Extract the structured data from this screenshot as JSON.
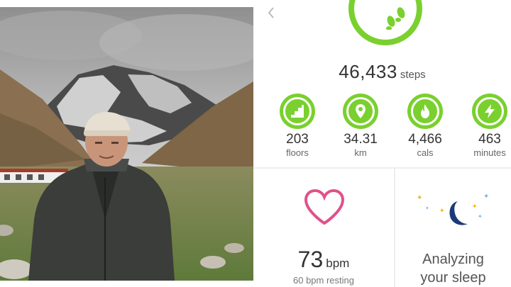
{
  "photo": {
    "subject": "person-in-jacket-before-snowy-mountain"
  },
  "colors": {
    "accent": "#7ad02e",
    "heart": "#e0518a",
    "moon": "#1d3a78"
  },
  "dashboard": {
    "steps": {
      "value": "46,433",
      "unit": "steps",
      "icon": "shoe-prints-icon"
    },
    "stats": [
      {
        "value": "203",
        "unit": "floors",
        "icon": "stairs-icon"
      },
      {
        "value": "34.31",
        "unit": "km",
        "icon": "location-pin-icon"
      },
      {
        "value": "4,466",
        "unit": "cals",
        "icon": "flame-icon"
      },
      {
        "value": "463",
        "unit": "minutes",
        "icon": "lightning-icon"
      }
    ],
    "heart": {
      "value": "73",
      "unit": "bpm",
      "resting": "60 bpm resting",
      "icon": "heart-icon"
    },
    "sleep": {
      "line1": "Analyzing",
      "line2": "your sleep",
      "icon": "moon-stars-icon"
    }
  }
}
